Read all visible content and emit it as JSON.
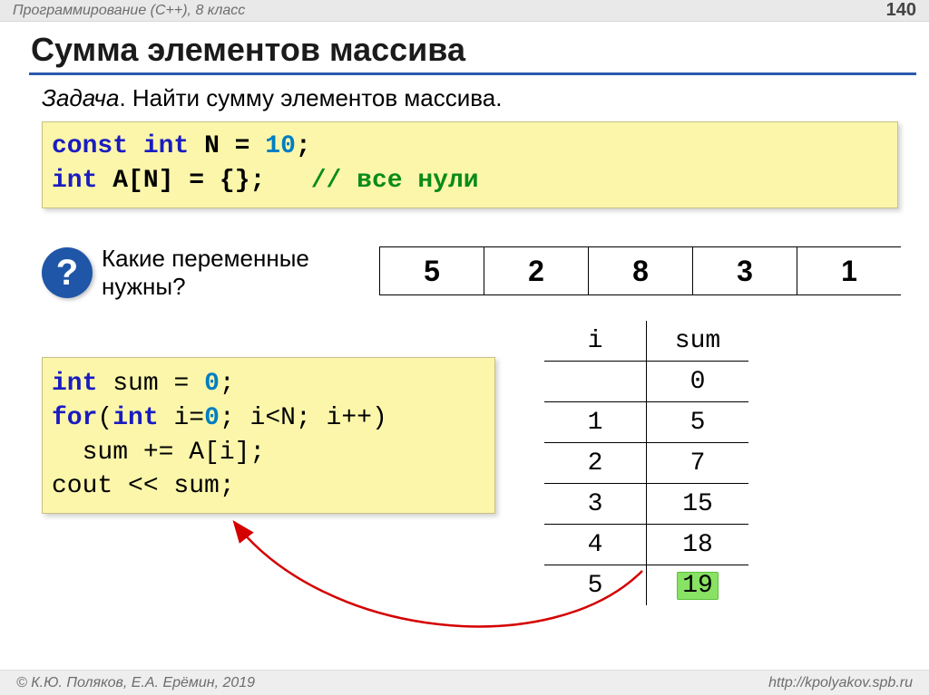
{
  "header": {
    "left": "Программирование (C++), 8 класс",
    "page": "140"
  },
  "title": "Сумма элементов массива",
  "task": {
    "label": "Задача",
    "text": ". Найти сумму элементов массива."
  },
  "code1": {
    "l1": {
      "const": "const",
      "int": "int",
      "n": "N",
      "eq": " = ",
      "ten": "10",
      "semi": ";"
    },
    "l2": {
      "int": "int",
      "a": "A",
      "lb": "[",
      "n": "N",
      "rb": "]",
      "eq": " = ",
      "braces": "{}",
      "semi": ";   ",
      "cmt": "// все нули"
    }
  },
  "question": {
    "badge": "?",
    "line1": "Какие переменные",
    "line2": "нужны?"
  },
  "array": [
    "5",
    "2",
    "8",
    "3",
    "1"
  ],
  "trace": {
    "head": {
      "i": "i",
      "sum": "sum"
    },
    "rows": [
      {
        "i": "",
        "sum": "0"
      },
      {
        "i": "1",
        "sum": "5"
      },
      {
        "i": "2",
        "sum": "7"
      },
      {
        "i": "3",
        "sum": "15"
      },
      {
        "i": "4",
        "sum": "18"
      },
      {
        "i": "5",
        "sum": "19"
      }
    ]
  },
  "code2": {
    "l1": {
      "int": "int",
      "sum": "sum",
      "eq": " = ",
      "zero": "0",
      "semi": ";"
    },
    "l2": {
      "for": "for",
      "lp": "(",
      "int": "int",
      "i": "i",
      "eq1": "=",
      "zero": "0",
      "semi1": "; ",
      "ilt": "i<N",
      "semi2": "; ",
      "ipp": "i++",
      "rp": ")"
    },
    "l3": "  sum += A[i];",
    "l4": "cout << sum;"
  },
  "footer": {
    "left": "© К.Ю. Поляков, Е.А. Ерёмин, 2019",
    "right": "http://kpolyakov.spb.ru"
  }
}
